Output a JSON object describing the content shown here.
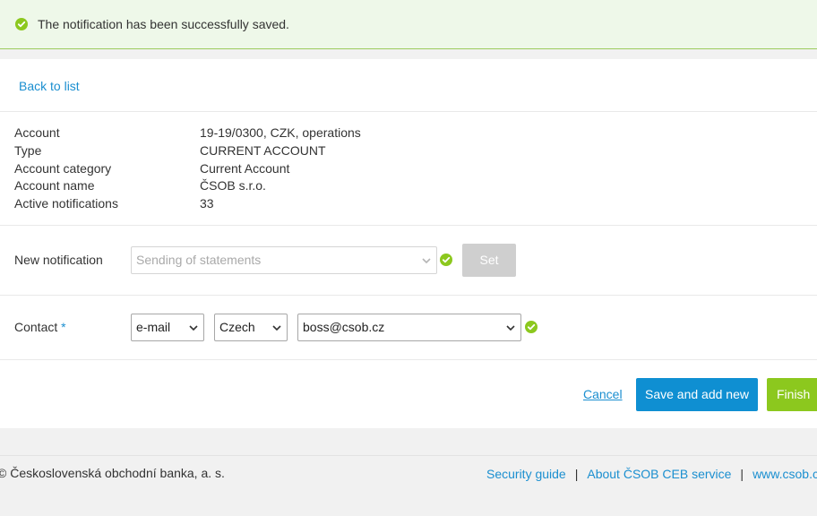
{
  "notification": {
    "message": "The notification has been successfully saved.",
    "icon": "check-circle-icon",
    "color": "#8cc81e"
  },
  "nav": {
    "back_label": "Back to list"
  },
  "account_info": [
    {
      "label": "Account",
      "value": "19-19/0300, CZK, operations"
    },
    {
      "label": "Type",
      "value": "CURRENT ACCOUNT"
    },
    {
      "label": "Account category",
      "value": "Current Account"
    },
    {
      "label": "Account name",
      "value": "ČSOB s.r.o."
    },
    {
      "label": "Active notifications",
      "value": "33"
    }
  ],
  "new_notification": {
    "label": "New notification",
    "select_value": "Sending of statements",
    "set_label": "Set"
  },
  "contact": {
    "label": "Contact",
    "required_mark": "*",
    "method": "e-mail",
    "language": "Czech",
    "address": "boss@csob.cz"
  },
  "actions": {
    "cancel": "Cancel",
    "save_add": "Save and add new",
    "finish": "Finish"
  },
  "footer": {
    "copyright": "© Československá obchodní banka, a. s.",
    "links": [
      "Security guide",
      "About ČSOB CEB service",
      "www.csob.cz"
    ],
    "separator": "|"
  },
  "colors": {
    "link": "#1b8fd0",
    "primary_button": "#0f8fd2",
    "finish_button": "#8cc81e",
    "banner_bg": "#eef8e9"
  }
}
